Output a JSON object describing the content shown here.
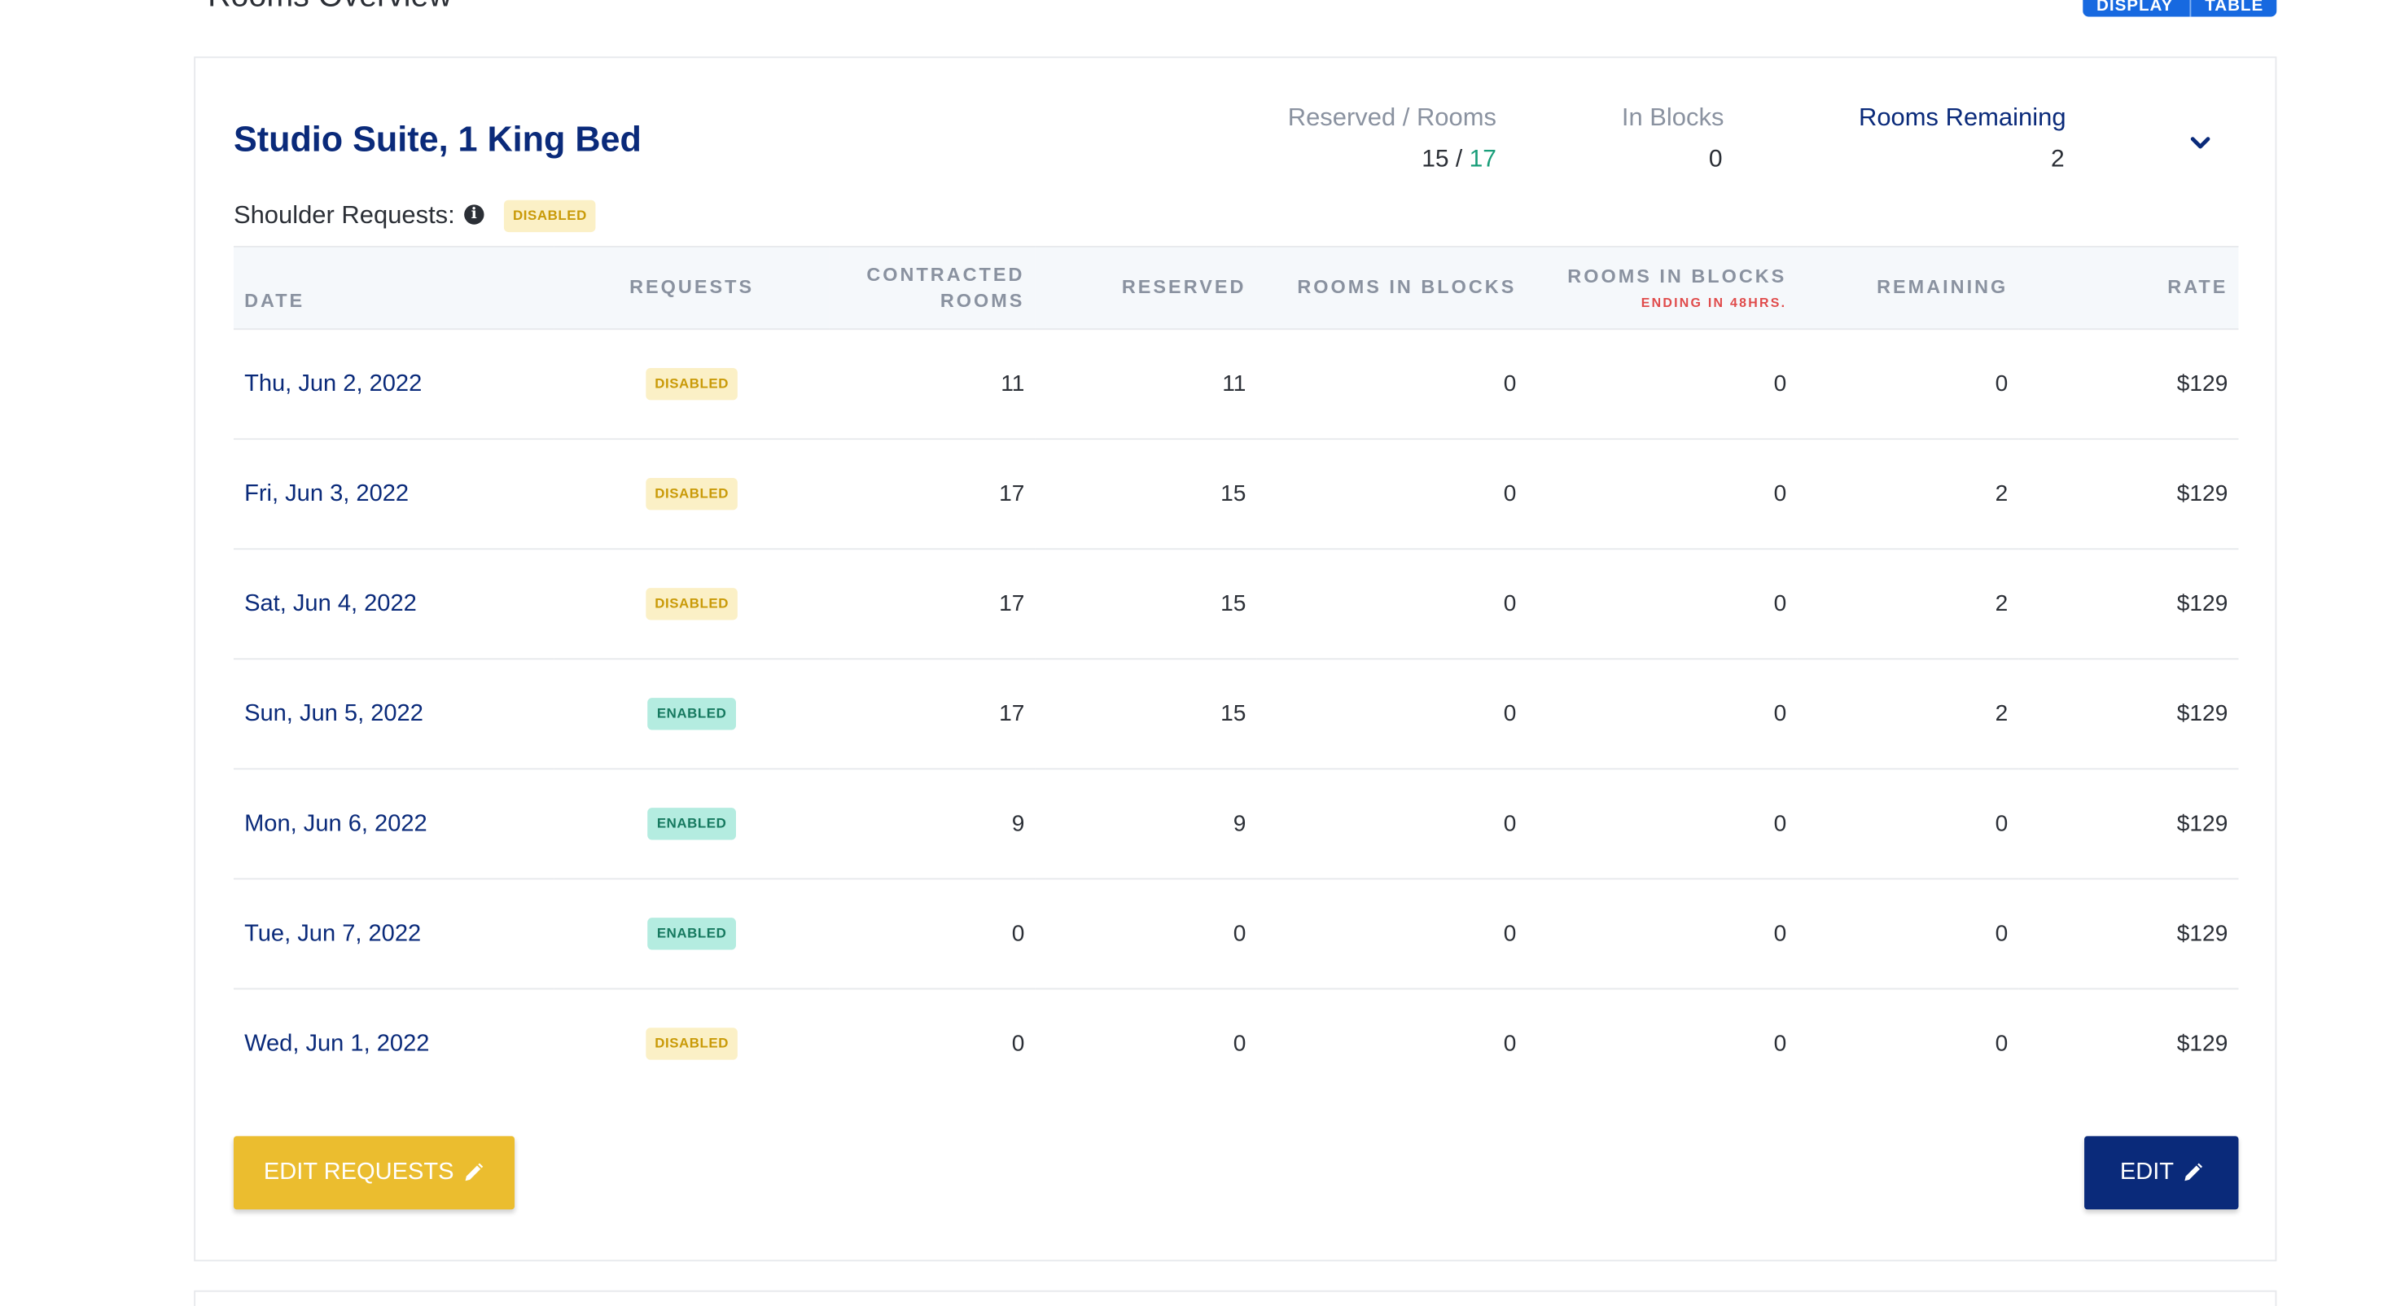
{
  "page": {
    "title": "Rooms Overview",
    "view_toggle": [
      "DISPLAY",
      "TABLE"
    ]
  },
  "room": {
    "title": "Studio Suite, 1 King Bed",
    "shoulder_label": "Shoulder Requests:",
    "shoulder_status": "DISABLED",
    "stats": {
      "reserved_rooms_label": "Reserved / Rooms",
      "reserved": "15",
      "separator": " / ",
      "rooms": "17",
      "in_blocks_label": "In Blocks",
      "in_blocks": "0",
      "remaining_label": "Rooms Remaining",
      "remaining": "2"
    }
  },
  "table": {
    "headers": {
      "date": "DATE",
      "requests": "REQUESTS",
      "contracted": "CONTRACTED ROOMS",
      "reserved": "RESERVED",
      "rooms_in_blocks": "ROOMS IN BLOCKS",
      "rooms_in_blocks_ending": "ROOMS IN BLOCKS",
      "ending_note": "ENDING IN 48HRS.",
      "remaining": "REMAINING",
      "rate": "RATE"
    },
    "rows": [
      {
        "date": "Thu, Jun 2, 2022",
        "requests": "DISABLED",
        "status": "disabled",
        "contracted": "11",
        "reserved": "11",
        "in_blocks": "0",
        "ending": "0",
        "remaining": "0",
        "rate": "$129"
      },
      {
        "date": "Fri, Jun 3, 2022",
        "requests": "DISABLED",
        "status": "disabled",
        "contracted": "17",
        "reserved": "15",
        "in_blocks": "0",
        "ending": "0",
        "remaining": "2",
        "rate": "$129"
      },
      {
        "date": "Sat, Jun 4, 2022",
        "requests": "DISABLED",
        "status": "disabled",
        "contracted": "17",
        "reserved": "15",
        "in_blocks": "0",
        "ending": "0",
        "remaining": "2",
        "rate": "$129"
      },
      {
        "date": "Sun, Jun 5, 2022",
        "requests": "ENABLED",
        "status": "enabled",
        "contracted": "17",
        "reserved": "15",
        "in_blocks": "0",
        "ending": "0",
        "remaining": "2",
        "rate": "$129"
      },
      {
        "date": "Mon, Jun 6, 2022",
        "requests": "ENABLED",
        "status": "enabled",
        "contracted": "9",
        "reserved": "9",
        "in_blocks": "0",
        "ending": "0",
        "remaining": "0",
        "rate": "$129"
      },
      {
        "date": "Tue, Jun 7, 2022",
        "requests": "ENABLED",
        "status": "enabled",
        "contracted": "0",
        "reserved": "0",
        "in_blocks": "0",
        "ending": "0",
        "remaining": "0",
        "rate": "$129"
      },
      {
        "date": "Wed, Jun 1, 2022",
        "requests": "DISABLED",
        "status": "disabled",
        "contracted": "0",
        "reserved": "0",
        "in_blocks": "0",
        "ending": "0",
        "remaining": "0",
        "rate": "$129"
      }
    ]
  },
  "buttons": {
    "edit_requests": "EDIT REQUESTS",
    "edit": "EDIT"
  },
  "icons": {
    "info": "info-icon",
    "chevron": "chevron-down-icon",
    "pencil": "pencil-icon"
  },
  "colors": {
    "navy": "#0a2a7a",
    "gold": "#ebbd2f",
    "green": "#1a9e7a",
    "blue_toggle": "#1769e0",
    "red_note": "#e04b4b"
  }
}
